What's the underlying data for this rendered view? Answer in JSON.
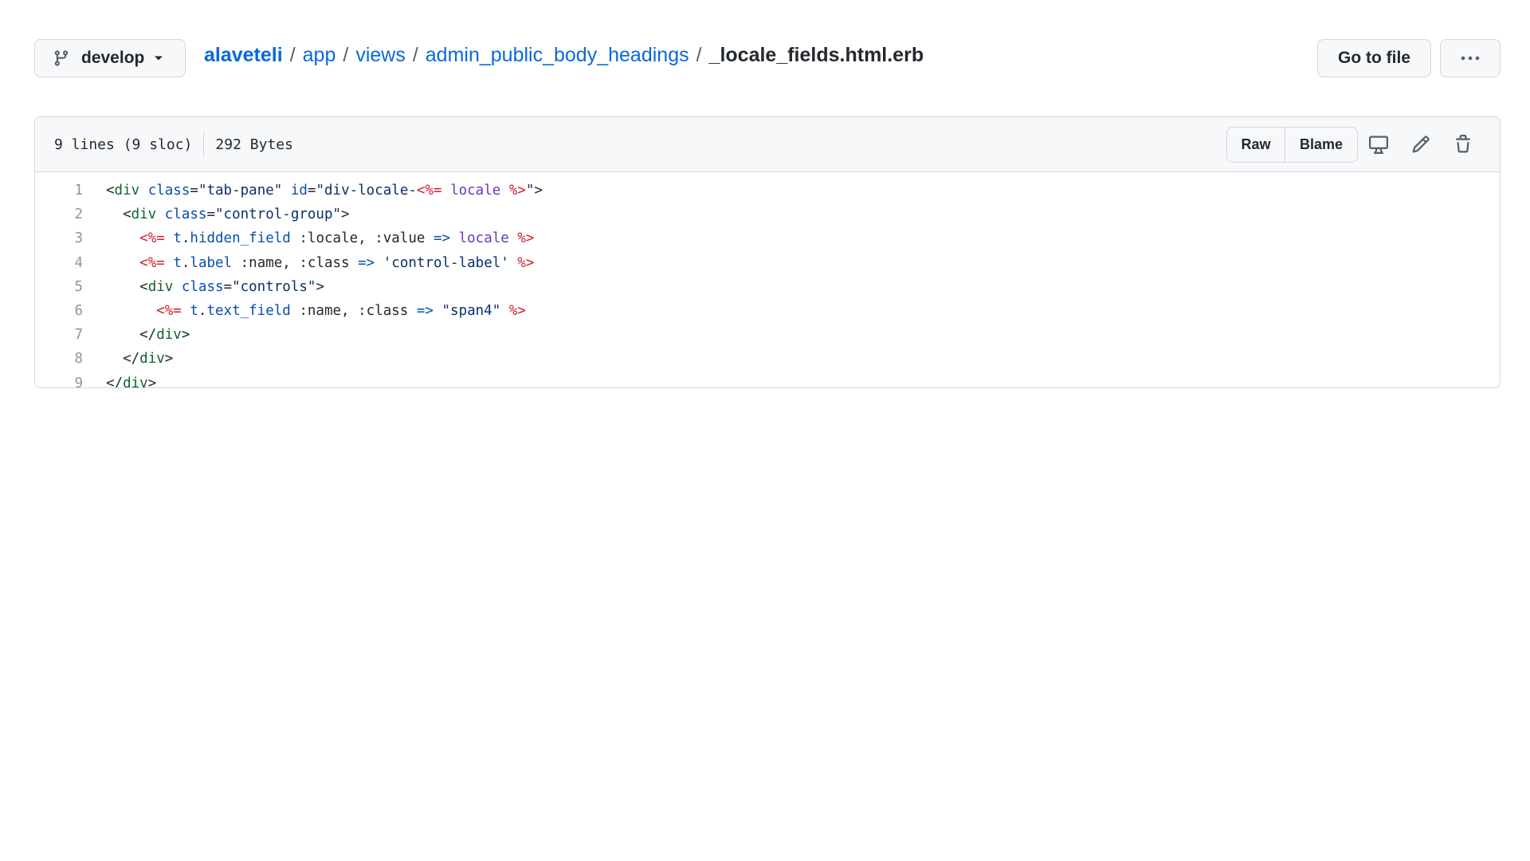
{
  "branch": {
    "label": "develop"
  },
  "breadcrumb": {
    "repo": "alaveteli",
    "segments": [
      "app",
      "views",
      "admin_public_body_headings"
    ],
    "separator": "/",
    "current": "_locale_fields.html.erb"
  },
  "actions": {
    "goto_label": "Go to file",
    "more_icon": "kebab-horizontal-icon"
  },
  "file": {
    "lines_info": "9 lines (9 sloc)",
    "size": "292 Bytes",
    "raw_label": "Raw",
    "blame_label": "Blame",
    "icons": [
      "desktop-icon",
      "pencil-icon",
      "trash-icon"
    ]
  },
  "colors": {
    "link": "#0969da",
    "tag": "#116329",
    "attr": "#0550ae",
    "string": "#0a3069",
    "erb": "#cf222e",
    "identifier": "#6639ba"
  },
  "code_lines": [
    {
      "n": "1",
      "tokens": [
        [
          "plain",
          "<"
        ],
        [
          "tag",
          "div"
        ],
        [
          "plain",
          " "
        ],
        [
          "attr",
          "class"
        ],
        [
          "plain",
          "="
        ],
        [
          "str",
          "\"tab-pane\""
        ],
        [
          "plain",
          " "
        ],
        [
          "attr",
          "id"
        ],
        [
          "plain",
          "="
        ],
        [
          "str",
          "\"div-locale-"
        ],
        [
          "erb",
          "<%="
        ],
        [
          "plain",
          " "
        ],
        [
          "id",
          "locale"
        ],
        [
          "plain",
          " "
        ],
        [
          "erb",
          "%>"
        ],
        [
          "str",
          "\""
        ],
        [
          "plain",
          ">"
        ]
      ]
    },
    {
      "n": "2",
      "tokens": [
        [
          "plain",
          "  <"
        ],
        [
          "tag",
          "div"
        ],
        [
          "plain",
          " "
        ],
        [
          "attr",
          "class"
        ],
        [
          "plain",
          "="
        ],
        [
          "str",
          "\"control-group\""
        ],
        [
          "plain",
          ">"
        ]
      ]
    },
    {
      "n": "3",
      "tokens": [
        [
          "plain",
          "    "
        ],
        [
          "erb",
          "<%="
        ],
        [
          "plain",
          " "
        ],
        [
          "attr",
          "t"
        ],
        [
          "plain",
          "."
        ],
        [
          "attr",
          "hidden_field"
        ],
        [
          "plain",
          " :locale, :value "
        ],
        [
          "attr",
          "=>"
        ],
        [
          "plain",
          " "
        ],
        [
          "id",
          "locale"
        ],
        [
          "plain",
          " "
        ],
        [
          "erb",
          "%>"
        ]
      ]
    },
    {
      "n": "4",
      "tokens": [
        [
          "plain",
          "    "
        ],
        [
          "erb",
          "<%="
        ],
        [
          "plain",
          " "
        ],
        [
          "attr",
          "t"
        ],
        [
          "plain",
          "."
        ],
        [
          "attr",
          "label"
        ],
        [
          "plain",
          " :name, :class "
        ],
        [
          "attr",
          "=>"
        ],
        [
          "plain",
          " "
        ],
        [
          "str",
          "'control-label'"
        ],
        [
          "plain",
          " "
        ],
        [
          "erb",
          "%>"
        ]
      ]
    },
    {
      "n": "5",
      "tokens": [
        [
          "plain",
          "    <"
        ],
        [
          "tag",
          "div"
        ],
        [
          "plain",
          " "
        ],
        [
          "attr",
          "class"
        ],
        [
          "plain",
          "="
        ],
        [
          "str",
          "\"controls\""
        ],
        [
          "plain",
          ">"
        ]
      ]
    },
    {
      "n": "6",
      "tokens": [
        [
          "plain",
          "      "
        ],
        [
          "erb",
          "<%="
        ],
        [
          "plain",
          " "
        ],
        [
          "attr",
          "t"
        ],
        [
          "plain",
          "."
        ],
        [
          "attr",
          "text_field"
        ],
        [
          "plain",
          " :name, :class "
        ],
        [
          "attr",
          "=>"
        ],
        [
          "plain",
          " "
        ],
        [
          "str",
          "\"span4\""
        ],
        [
          "plain",
          " "
        ],
        [
          "erb",
          "%>"
        ]
      ]
    },
    {
      "n": "7",
      "tokens": [
        [
          "plain",
          "    </"
        ],
        [
          "tag",
          "div"
        ],
        [
          "plain",
          ">"
        ]
      ]
    },
    {
      "n": "8",
      "tokens": [
        [
          "plain",
          "  </"
        ],
        [
          "tag",
          "div"
        ],
        [
          "plain",
          ">"
        ]
      ]
    },
    {
      "n": "9",
      "tokens": [
        [
          "plain",
          "</"
        ],
        [
          "tag",
          "div"
        ],
        [
          "plain",
          ">"
        ]
      ]
    }
  ]
}
